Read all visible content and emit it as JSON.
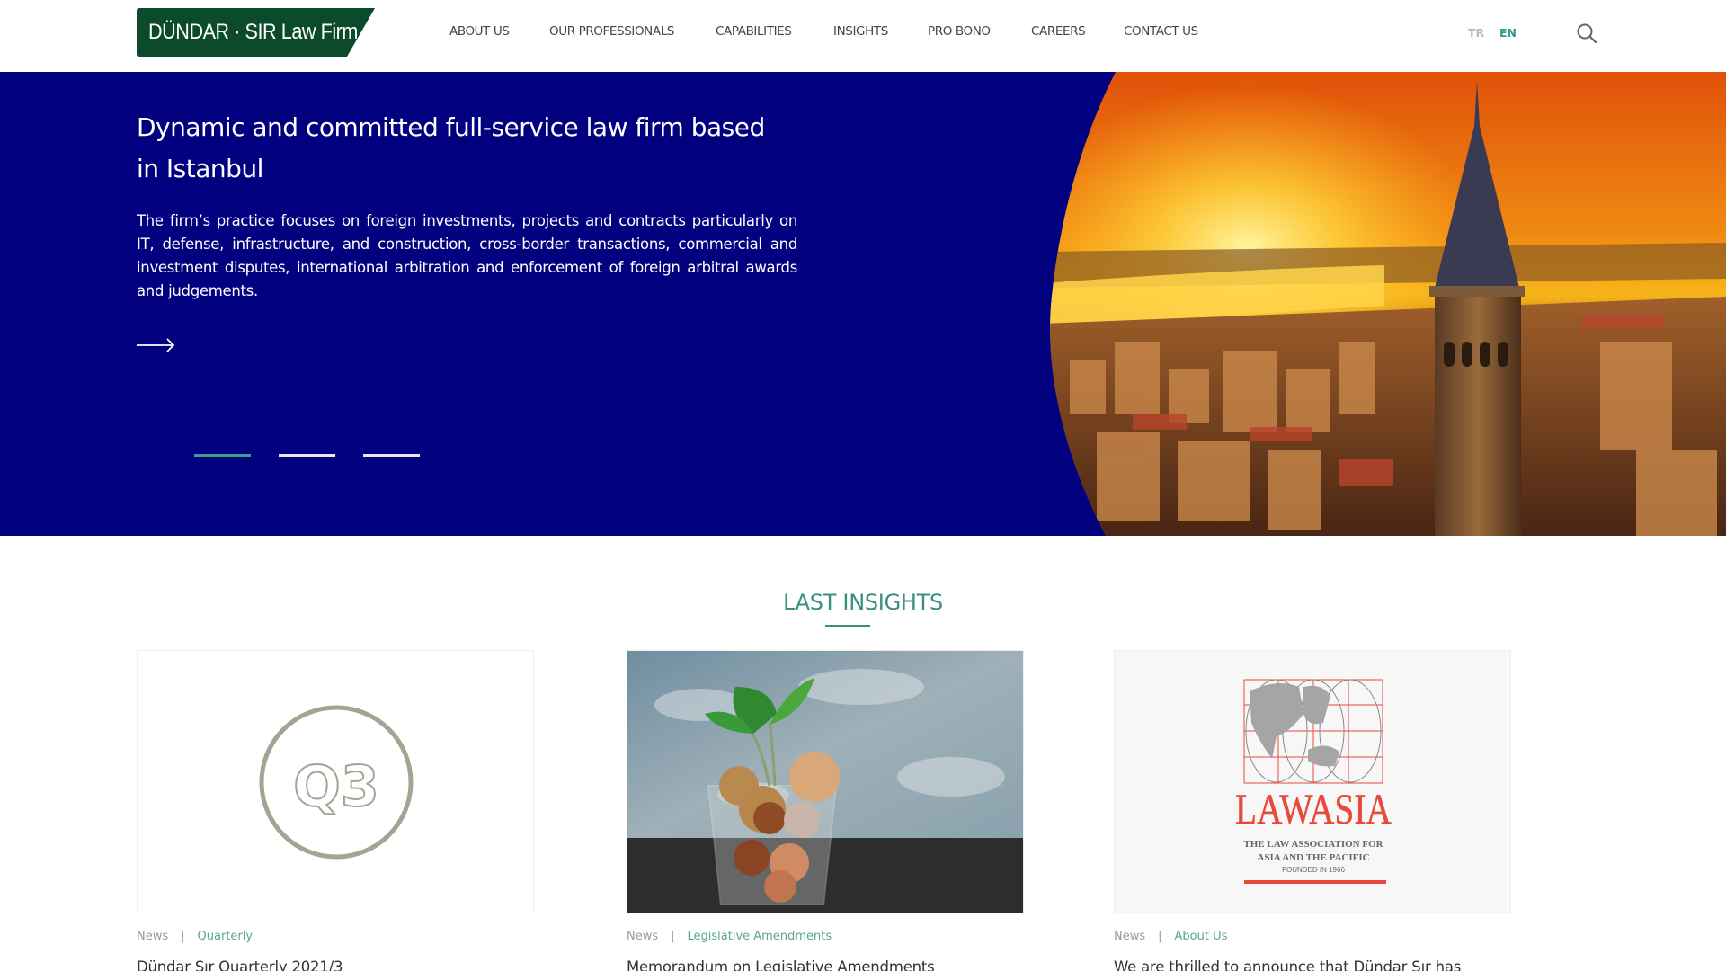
{
  "header": {
    "logo_text": "DÜNDAR · SIR  Law Firm",
    "brand_color": "#0b4a2b",
    "nav": [
      {
        "label": "ABOUT US"
      },
      {
        "label": "OUR PROFESSIONALS"
      },
      {
        "label": "CAPABILITIES"
      },
      {
        "label": "INSIGHTS"
      },
      {
        "label": "PRO BONO"
      },
      {
        "label": "CAREERS"
      },
      {
        "label": "CONTACT US"
      }
    ],
    "languages": {
      "tr": "TR",
      "en": "EN",
      "active": "EN"
    },
    "search_icon": "search-icon"
  },
  "hero": {
    "background_color": "#01017f",
    "title": "Dynamic and committed full-service law firm based in Istanbul",
    "text": "The firm’s practice focuses on foreign investments, projects and contracts particularly on IT, defense, infrastructure, and construction, cross-border transactions, commercial and investment disputes, international arbitration and enforcement of foreign arbitral awards and judgements.",
    "arrow_icon": "arrow-right-icon",
    "image": "istanbul-galata-tower-sunset",
    "slides": {
      "count": 3,
      "active": 1
    }
  },
  "insights": {
    "title": "LAST INSIGHTS",
    "accent_color": "#3b8f7f",
    "cards": [
      {
        "type": "News",
        "category": "Quarterly",
        "title": "Dündar Sır Quarterly 2021/3",
        "image": "q3-badge",
        "badge_text": "Q3"
      },
      {
        "type": "News",
        "category": "Legislative Amendments",
        "title": "Memorandum on Legislative Amendments",
        "image": "coins-plant-jar"
      },
      {
        "type": "News",
        "category": "About Us",
        "title": "We are thrilled to announce that Dündar Sır has",
        "image": "lawasia-logo",
        "logo": {
          "name": "LAWASIA",
          "line1": "THE LAW ASSOCIATION FOR",
          "line2": "ASIA AND THE PACIFIC",
          "line3": "FOUNDED IN 1966"
        }
      }
    ]
  }
}
